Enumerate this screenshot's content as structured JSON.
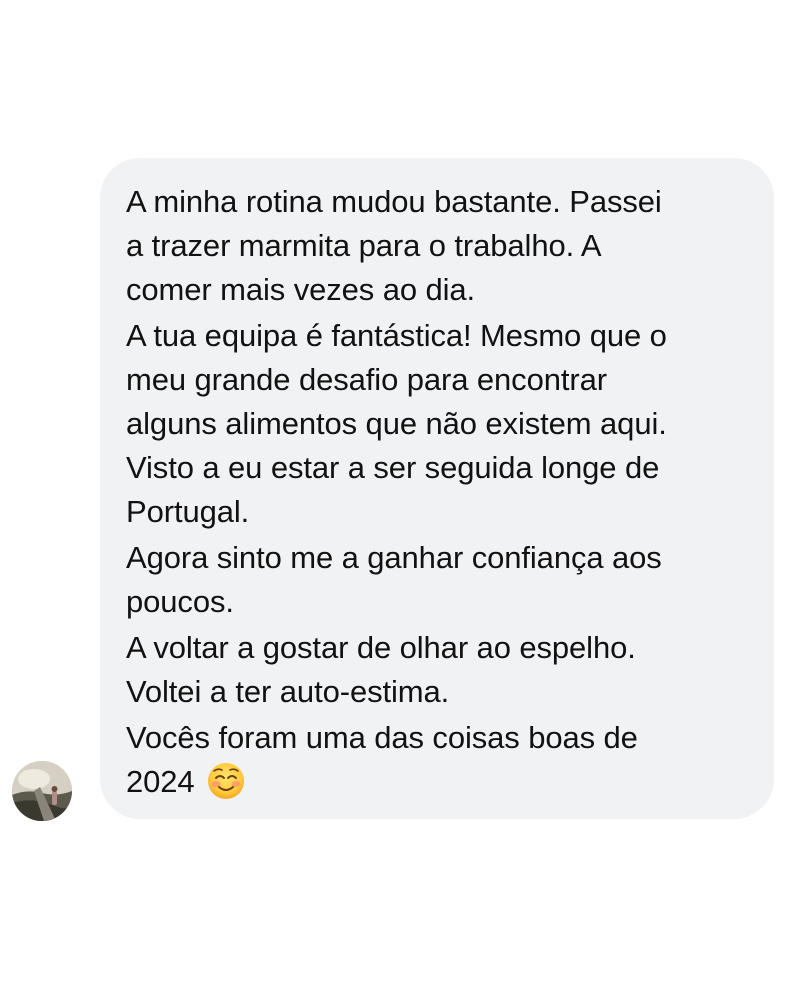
{
  "message": {
    "paragraphs": [
      {
        "lines": [
          "A minha rotina mudou bastante. Passei",
          "a trazer marmita para o trabalho. A",
          "comer mais vezes ao dia."
        ]
      },
      {
        "lines": [
          "A tua equipa é fantástica! Mesmo que o",
          "meu grande desafio para encontrar",
          "alguns alimentos que não existem aqui.",
          "Visto a eu estar a ser seguida longe de",
          "Portugal."
        ]
      },
      {
        "lines": [
          "Agora sinto me a ganhar confiança aos",
          "poucos."
        ]
      },
      {
        "lines": [
          "A voltar a gostar de olhar ao espelho.",
          "Voltei a ter auto-estima."
        ]
      },
      {
        "lines": [
          "Vocês foram uma das coisas boas de",
          "2024"
        ]
      }
    ],
    "emoji": "smiling-face-blushing-emoji"
  },
  "avatar": {
    "icon": "profile-photo"
  },
  "colors": {
    "bubble": "#f1f2f4",
    "text": "#121212",
    "background": "#ffffff"
  }
}
